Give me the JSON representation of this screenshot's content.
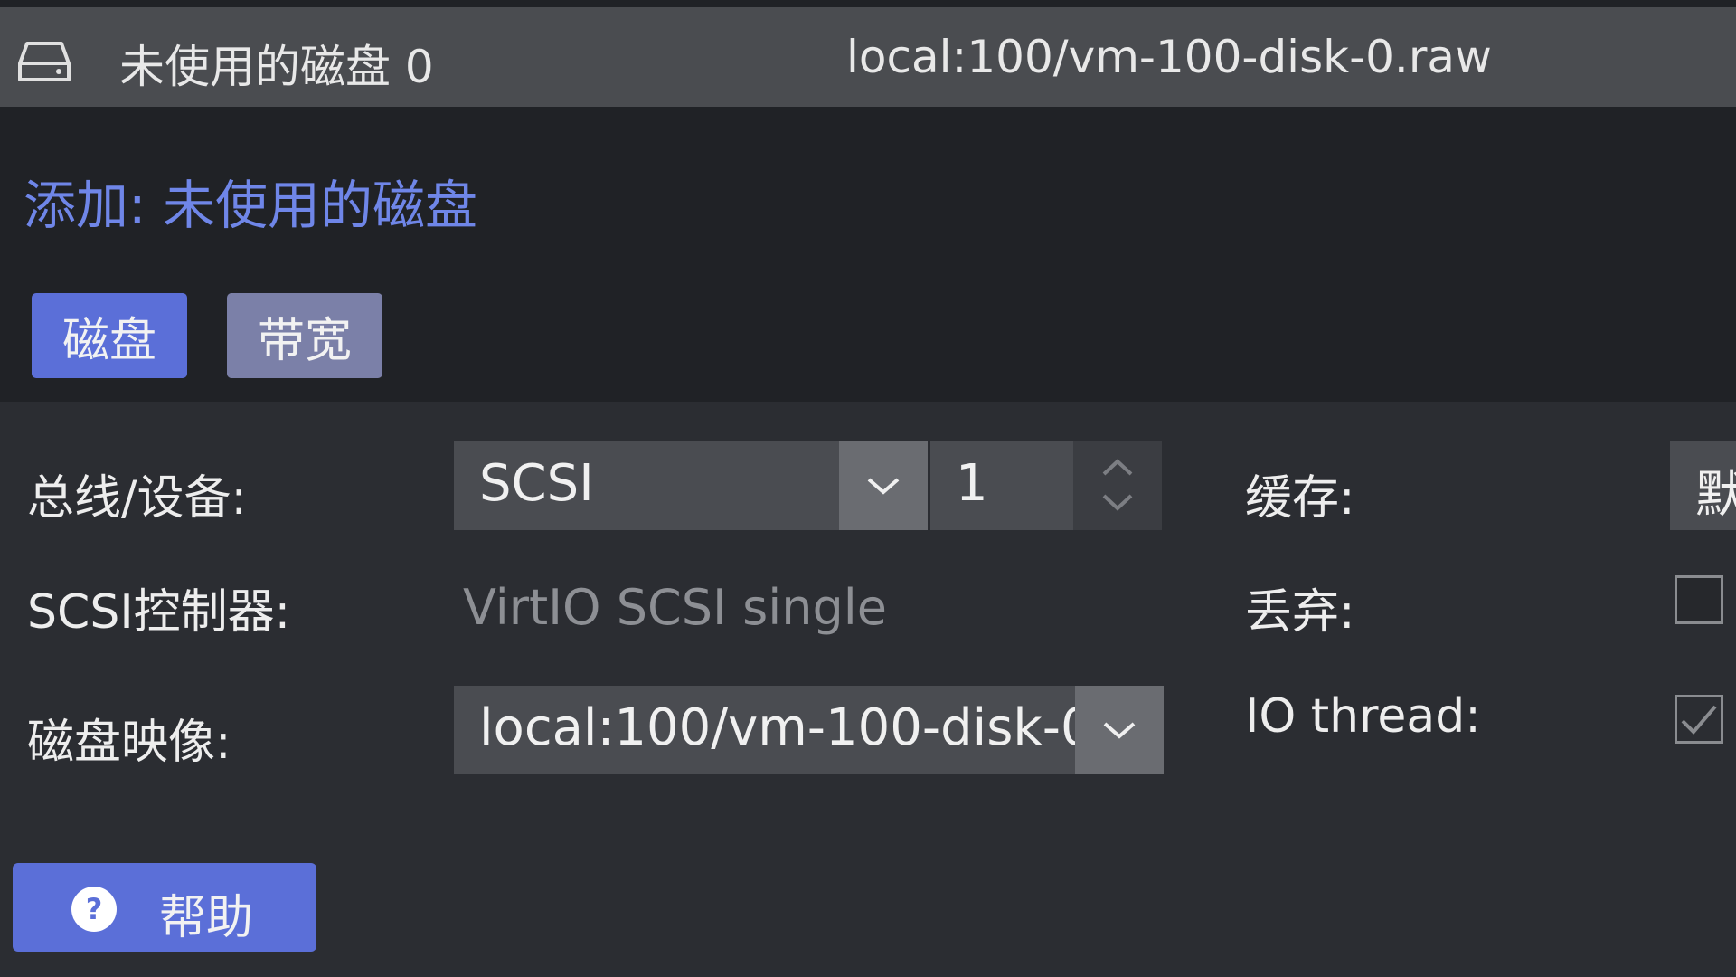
{
  "header": {
    "label": "未使用的磁盘 0",
    "value": "local:100/vm-100-disk-0.raw",
    "icon": "hard-drive-icon"
  },
  "dialog": {
    "title": "添加: 未使用的磁盘",
    "tabs": [
      {
        "label": "磁盘",
        "active": true
      },
      {
        "label": "带宽",
        "active": false
      }
    ]
  },
  "form": {
    "bus_device_label": "总线/设备:",
    "bus_value": "SCSI",
    "device_number": "1",
    "scsi_controller_label": "SCSI控制器:",
    "scsi_controller_value": "VirtIO SCSI single",
    "disk_image_label": "磁盘映像:",
    "disk_image_value": "local:100/vm-100-disk-0.",
    "cache_label": "缓存:",
    "cache_value": "默",
    "discard_label": "丢弃:",
    "discard_checked": false,
    "io_thread_label": "IO thread:",
    "io_thread_checked": true
  },
  "footer": {
    "help_label": "帮助",
    "help_icon": "question-circle-icon"
  },
  "colors": {
    "accent": "#5b6fd8",
    "title": "#6f86e8",
    "inactive_tab": "#7b80a8"
  }
}
